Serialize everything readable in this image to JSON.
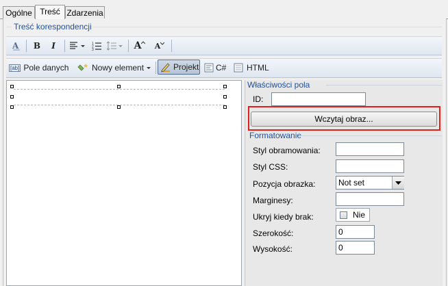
{
  "tabs": [
    {
      "label": "Ogólne"
    },
    {
      "label": "Treść"
    },
    {
      "label": "Zdarzenia"
    }
  ],
  "group": {
    "title": "Treść korespondencji"
  },
  "format_toolbar": {
    "bold_label": "B",
    "italic_label": "I",
    "font_grow_label": "A",
    "font_shrink_label": "A"
  },
  "insert_toolbar": {
    "fields_icon_text": "[ab]",
    "fields_label": "Pole danych",
    "new_element_label": "Nowy element",
    "design_label": "Projekt",
    "csharp_label": "C#",
    "html_label": "HTML"
  },
  "properties": {
    "title": "Właściwości pola",
    "id_label": "ID:",
    "id_value": "",
    "load_image_label": "Wczytaj obraz...",
    "formatting_title": "Formatowanie",
    "border_style_label": "Styl obramowania:",
    "border_style_value": "",
    "css_style_label": "Styl CSS:",
    "css_style_value": "",
    "image_position_label": "Pozycja obrazka:",
    "image_position_value": "Not set",
    "margins_label": "Marginesy:",
    "margins_value": "",
    "hide_when_empty_label": "Ukryj kiedy brak:",
    "hide_when_empty_value": "Nie",
    "hide_when_empty_checked": false,
    "width_label": "Szerokość:",
    "width_value": "0",
    "height_label": "Wysokość:",
    "height_value": "0"
  },
  "colors": {
    "highlight": "#e0201b",
    "group_title": "#1f4e9c"
  }
}
